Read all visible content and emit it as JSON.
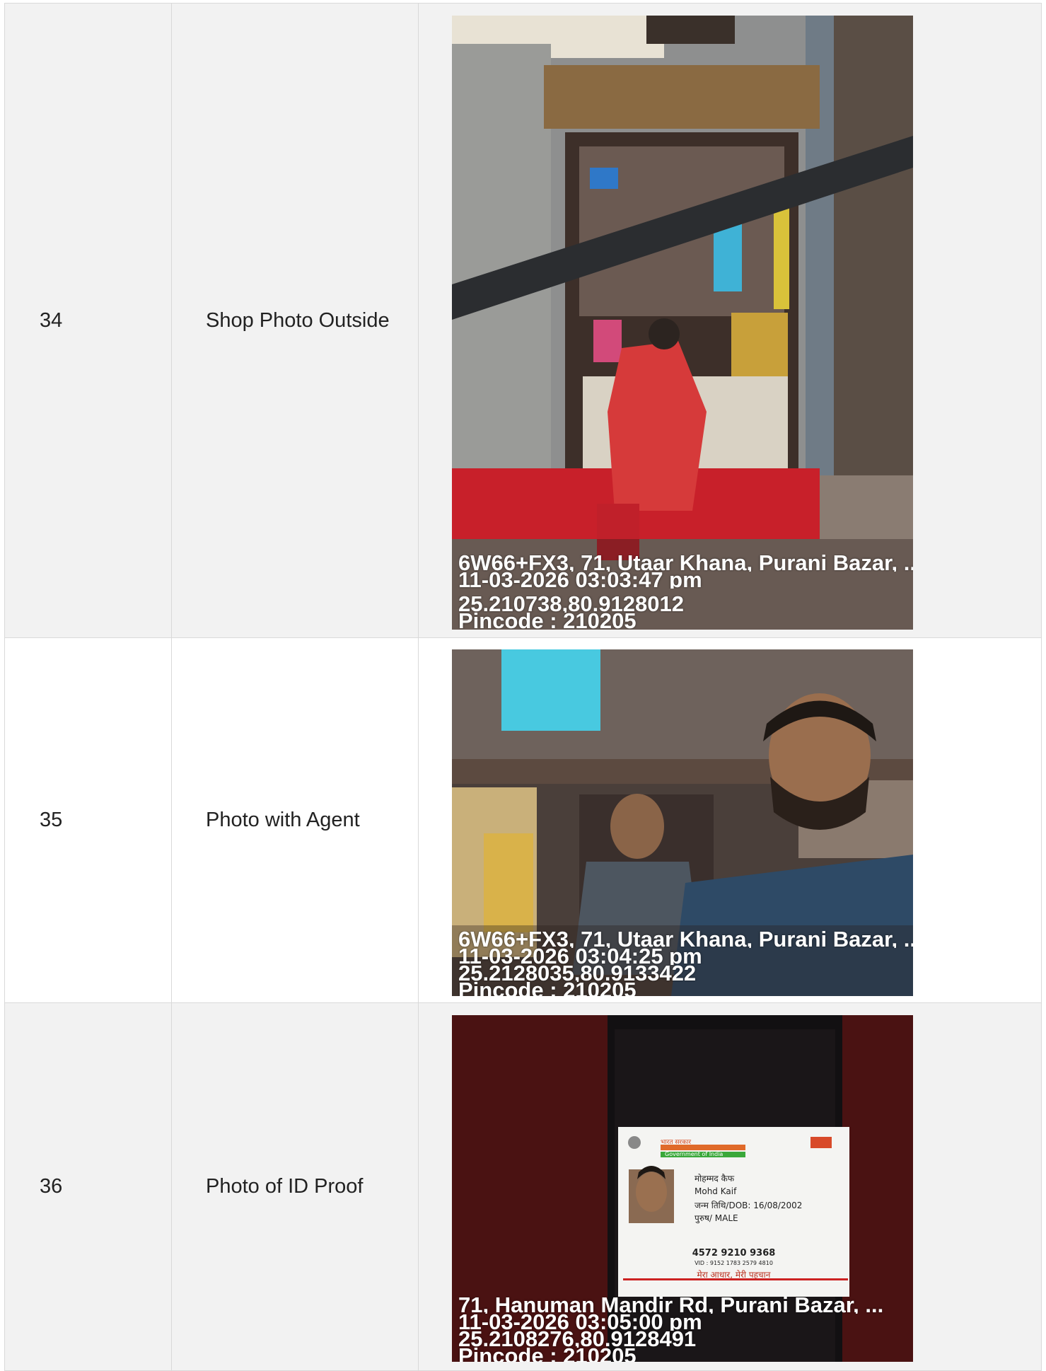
{
  "rows": [
    {
      "number": "34",
      "label": "Shop Photo Outside",
      "photo_icon": "shop-front-photo",
      "geotag": {
        "address": "6W66+FX3, 71, Utaar Khana, Purani Bazar, ...",
        "timestamp": "11-03-2026 03:03:47 pm",
        "coordinates": "25.210738,80.9128012",
        "pincode": "Pincode : 210205"
      }
    },
    {
      "number": "35",
      "label": "Photo with Agent",
      "photo_icon": "agent-selfie-photo",
      "geotag": {
        "address": "6W66+FX3, 71, Utaar Khana, Purani Bazar, ...",
        "timestamp": "11-03-2026 03:04:25 pm",
        "coordinates": "25.2128035,80.9133422",
        "pincode": "Pincode : 210205"
      }
    },
    {
      "number": "36",
      "label": "Photo of ID Proof",
      "photo_icon": "id-card-photo",
      "id_card": {
        "header_hi": "भारत सरकार",
        "header_en": "Government of India",
        "name_hi": "मोहम्मद कैफ",
        "name_en": "Mohd Kaif",
        "dob": "जन्म तिथि/DOB: 16/08/2002",
        "gender": "पुरुष/ MALE",
        "number": "4572 9210 9368",
        "vid": "VID : 9152 1783 2579 4810",
        "tagline": "मेरा आधार, मेरी पहचान"
      },
      "geotag": {
        "address": "71, Hanuman Mandir Rd, Purani Bazar, ...",
        "timestamp": "11-03-2026 03:05:00 pm",
        "coordinates": "25.2108276,80.9128491",
        "pincode": "Pincode : 210205"
      }
    }
  ]
}
